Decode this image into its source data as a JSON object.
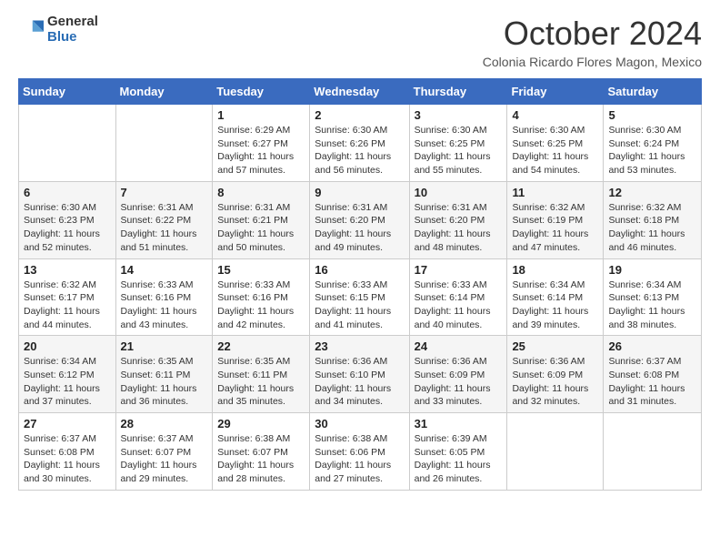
{
  "logo": {
    "general": "General",
    "blue": "Blue"
  },
  "title": "October 2024",
  "subtitle": "Colonia Ricardo Flores Magon, Mexico",
  "days_of_week": [
    "Sunday",
    "Monday",
    "Tuesday",
    "Wednesday",
    "Thursday",
    "Friday",
    "Saturday"
  ],
  "weeks": [
    [
      {
        "day": "",
        "info": ""
      },
      {
        "day": "",
        "info": ""
      },
      {
        "day": "1",
        "info": "Sunrise: 6:29 AM\nSunset: 6:27 PM\nDaylight: 11 hours and 57 minutes."
      },
      {
        "day": "2",
        "info": "Sunrise: 6:30 AM\nSunset: 6:26 PM\nDaylight: 11 hours and 56 minutes."
      },
      {
        "day": "3",
        "info": "Sunrise: 6:30 AM\nSunset: 6:25 PM\nDaylight: 11 hours and 55 minutes."
      },
      {
        "day": "4",
        "info": "Sunrise: 6:30 AM\nSunset: 6:25 PM\nDaylight: 11 hours and 54 minutes."
      },
      {
        "day": "5",
        "info": "Sunrise: 6:30 AM\nSunset: 6:24 PM\nDaylight: 11 hours and 53 minutes."
      }
    ],
    [
      {
        "day": "6",
        "info": "Sunrise: 6:30 AM\nSunset: 6:23 PM\nDaylight: 11 hours and 52 minutes."
      },
      {
        "day": "7",
        "info": "Sunrise: 6:31 AM\nSunset: 6:22 PM\nDaylight: 11 hours and 51 minutes."
      },
      {
        "day": "8",
        "info": "Sunrise: 6:31 AM\nSunset: 6:21 PM\nDaylight: 11 hours and 50 minutes."
      },
      {
        "day": "9",
        "info": "Sunrise: 6:31 AM\nSunset: 6:20 PM\nDaylight: 11 hours and 49 minutes."
      },
      {
        "day": "10",
        "info": "Sunrise: 6:31 AM\nSunset: 6:20 PM\nDaylight: 11 hours and 48 minutes."
      },
      {
        "day": "11",
        "info": "Sunrise: 6:32 AM\nSunset: 6:19 PM\nDaylight: 11 hours and 47 minutes."
      },
      {
        "day": "12",
        "info": "Sunrise: 6:32 AM\nSunset: 6:18 PM\nDaylight: 11 hours and 46 minutes."
      }
    ],
    [
      {
        "day": "13",
        "info": "Sunrise: 6:32 AM\nSunset: 6:17 PM\nDaylight: 11 hours and 44 minutes."
      },
      {
        "day": "14",
        "info": "Sunrise: 6:33 AM\nSunset: 6:16 PM\nDaylight: 11 hours and 43 minutes."
      },
      {
        "day": "15",
        "info": "Sunrise: 6:33 AM\nSunset: 6:16 PM\nDaylight: 11 hours and 42 minutes."
      },
      {
        "day": "16",
        "info": "Sunrise: 6:33 AM\nSunset: 6:15 PM\nDaylight: 11 hours and 41 minutes."
      },
      {
        "day": "17",
        "info": "Sunrise: 6:33 AM\nSunset: 6:14 PM\nDaylight: 11 hours and 40 minutes."
      },
      {
        "day": "18",
        "info": "Sunrise: 6:34 AM\nSunset: 6:14 PM\nDaylight: 11 hours and 39 minutes."
      },
      {
        "day": "19",
        "info": "Sunrise: 6:34 AM\nSunset: 6:13 PM\nDaylight: 11 hours and 38 minutes."
      }
    ],
    [
      {
        "day": "20",
        "info": "Sunrise: 6:34 AM\nSunset: 6:12 PM\nDaylight: 11 hours and 37 minutes."
      },
      {
        "day": "21",
        "info": "Sunrise: 6:35 AM\nSunset: 6:11 PM\nDaylight: 11 hours and 36 minutes."
      },
      {
        "day": "22",
        "info": "Sunrise: 6:35 AM\nSunset: 6:11 PM\nDaylight: 11 hours and 35 minutes."
      },
      {
        "day": "23",
        "info": "Sunrise: 6:36 AM\nSunset: 6:10 PM\nDaylight: 11 hours and 34 minutes."
      },
      {
        "day": "24",
        "info": "Sunrise: 6:36 AM\nSunset: 6:09 PM\nDaylight: 11 hours and 33 minutes."
      },
      {
        "day": "25",
        "info": "Sunrise: 6:36 AM\nSunset: 6:09 PM\nDaylight: 11 hours and 32 minutes."
      },
      {
        "day": "26",
        "info": "Sunrise: 6:37 AM\nSunset: 6:08 PM\nDaylight: 11 hours and 31 minutes."
      }
    ],
    [
      {
        "day": "27",
        "info": "Sunrise: 6:37 AM\nSunset: 6:08 PM\nDaylight: 11 hours and 30 minutes."
      },
      {
        "day": "28",
        "info": "Sunrise: 6:37 AM\nSunset: 6:07 PM\nDaylight: 11 hours and 29 minutes."
      },
      {
        "day": "29",
        "info": "Sunrise: 6:38 AM\nSunset: 6:07 PM\nDaylight: 11 hours and 28 minutes."
      },
      {
        "day": "30",
        "info": "Sunrise: 6:38 AM\nSunset: 6:06 PM\nDaylight: 11 hours and 27 minutes."
      },
      {
        "day": "31",
        "info": "Sunrise: 6:39 AM\nSunset: 6:05 PM\nDaylight: 11 hours and 26 minutes."
      },
      {
        "day": "",
        "info": ""
      },
      {
        "day": "",
        "info": ""
      }
    ]
  ]
}
